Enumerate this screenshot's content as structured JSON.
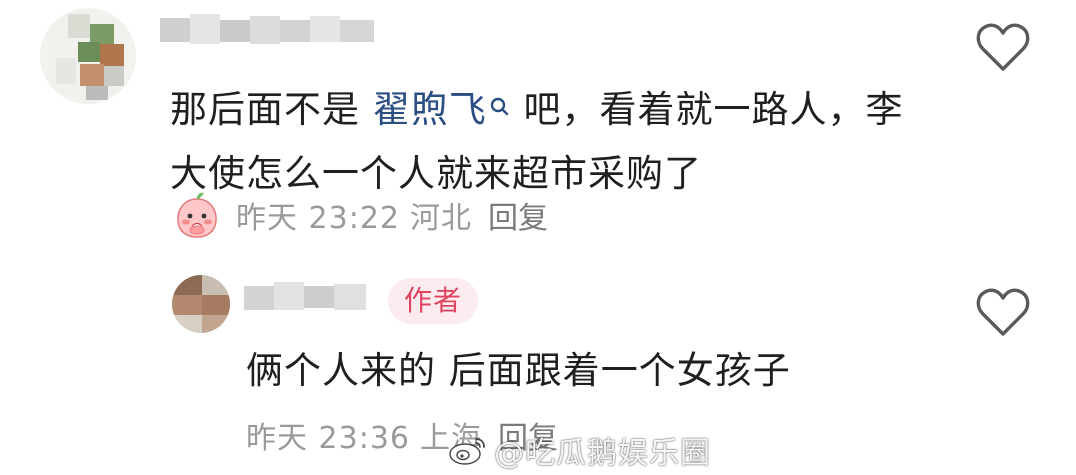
{
  "comments": [
    {
      "text_before": "那后面不是 ",
      "mention": "翟煦飞",
      "mention_icon": "search-icon",
      "text_after": " 吧，看着就一路人，李大使怎么一个人就来超市采购了",
      "time": "昨天 23:22",
      "location": "河北",
      "reply_label": "回复",
      "reaction_icon": "peach-emoji-icon"
    },
    {
      "badge": "作者",
      "text": "俩个人来的 后面跟着一个女孩子",
      "time": "昨天 23:36",
      "location": "上海",
      "reply_label": "回复"
    }
  ],
  "like_icon": "heart-outline-icon",
  "watermark": {
    "text": "@吃瓜鹅娱乐圈",
    "logo_icon": "weibo-logo"
  },
  "colors": {
    "mention": "#2a4d83",
    "meta": "#9a9a9a",
    "badge_bg": "#fdecef",
    "badge_text": "#e0455f",
    "heart_stroke": "#5a5a5a"
  }
}
